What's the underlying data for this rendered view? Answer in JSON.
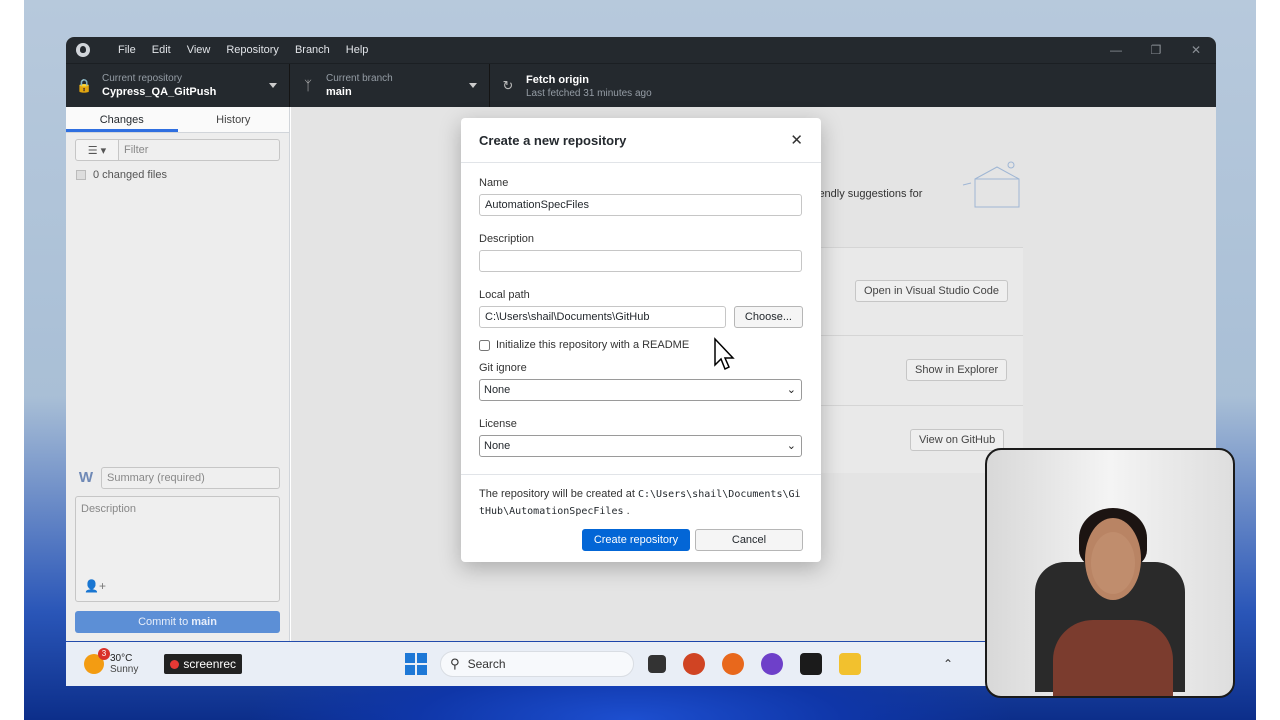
{
  "menu": [
    "File",
    "Edit",
    "View",
    "Repository",
    "Branch",
    "Help"
  ],
  "toolbar": {
    "repo_label": "Current repository",
    "repo_value": "Cypress_QA_GitPush",
    "branch_label": "Current branch",
    "branch_value": "main",
    "fetch_label": "Fetch origin",
    "fetch_sub": "Last fetched 31 minutes ago"
  },
  "sidebar": {
    "tabs": [
      "Changes",
      "History"
    ],
    "filter_placeholder": "Filter",
    "changed_files": "0 changed files",
    "summary_placeholder": "Summary (required)",
    "description_placeholder": "Description",
    "commit_prefix": "Commit to",
    "commit_branch": "main"
  },
  "main": {
    "suggestion_text": "iendly suggestions for",
    "open_editor": "Open in Visual Studio Code",
    "show_explorer": "Show in Explorer",
    "view_github": "View on GitHub"
  },
  "modal": {
    "title": "Create a new repository",
    "name_label": "Name",
    "name_value": "AutomationSpecFiles",
    "description_label": "Description",
    "description_value": "",
    "local_path_label": "Local path",
    "local_path_value": "C:\\Users\\shail\\Documents\\GitHub",
    "choose_label": "Choose...",
    "readme_label": "Initialize this repository with a README",
    "gitignore_label": "Git ignore",
    "gitignore_value": "None",
    "license_label": "License",
    "license_value": "None",
    "note_prefix": "The repository will be created at",
    "note_path_1": "C:\\Users\\shail\\Documents\\Gi",
    "note_path_2": "tHub\\AutomationSpecFiles",
    "note_suffix": ".",
    "create_label": "Create repository",
    "cancel_label": "Cancel"
  },
  "taskbar": {
    "weather_badge": "3",
    "temperature": "30°C",
    "condition": "Sunny",
    "screenrec": "screenrec",
    "search": "Search"
  },
  "colors": {
    "titlebar": "#24292e",
    "primary_button": "#0366d6",
    "tab_active": "#2f6fe0"
  }
}
